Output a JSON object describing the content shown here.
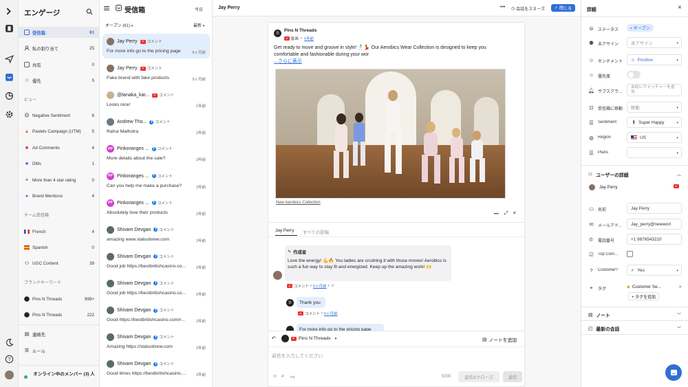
{
  "sidebar": {
    "title": "エンゲージ",
    "items": [
      {
        "label": "受信箱",
        "count": "61"
      },
      {
        "label": "私の割り当て",
        "count": "25"
      },
      {
        "label": "共有",
        "count": "0"
      },
      {
        "label": "優先",
        "count": "5"
      }
    ],
    "views_header": "ビュー",
    "views": [
      {
        "label": "Negative Sentiment",
        "count": "6"
      },
      {
        "label": "Pastels Campaign (UTM)",
        "count": "5"
      },
      {
        "label": "Ad Comments",
        "count": "4"
      },
      {
        "label": "DMs",
        "count": "1"
      },
      {
        "label": "More than 4 star rating",
        "count": "0"
      },
      {
        "label": "Brand Mentions",
        "count": "4"
      }
    ],
    "team_header": "チーム受信箱",
    "teams": [
      {
        "label": "French",
        "count": "4"
      },
      {
        "label": "Spanish",
        "count": "0"
      },
      {
        "label": "UGC Content",
        "count": "39"
      }
    ],
    "brand_header": "ブランドキーワード",
    "brands": [
      {
        "label": "Pins N Threads",
        "count": "999+"
      },
      {
        "label": "Pins N Threads",
        "count": "222"
      }
    ],
    "contacts": "連絡先",
    "rules": "ルール",
    "online": "オンライン中のメンバー (3) 人"
  },
  "list": {
    "title": "受信箱",
    "today": "今日",
    "filter": "オープン (61)",
    "sort": "最新",
    "items": [
      {
        "name": "Jay Perry",
        "channel": "yt",
        "tag": "コメント",
        "preview": "For more info go to the pricing page",
        "time": "5ヶ月前",
        "av": "JP"
      },
      {
        "name": "Jay Perry",
        "channel": "yt",
        "tag": "コメント",
        "preview": "Fake brand with fake products",
        "time": "5ヶ月前",
        "av": "JP"
      },
      {
        "name": "@tanaka_kar...",
        "channel": "yt",
        "tag": "コメント",
        "preview": "Looks nice!",
        "time": "1年前",
        "av": "T"
      },
      {
        "name": "Andrew Tho...",
        "channel": "fb",
        "tag": "コメント",
        "preview": "Rahul Malhotra",
        "time": "2年前",
        "av": "A"
      },
      {
        "name": "Pinkoranges ...",
        "channel": "fb",
        "tag": "コメント",
        "preview": "More details about the sale?",
        "time": "2年前",
        "av": "PP"
      },
      {
        "name": "Pinkoranges ...",
        "channel": "fb",
        "tag": "コメント",
        "preview": "Can you help me make a purchase?",
        "time": "2年前",
        "av": "PP"
      },
      {
        "name": "Pinkoranges ...",
        "channel": "fb",
        "tag": "コメント",
        "preview": "Absolutely love their products",
        "time": "2年前",
        "av": "PP"
      },
      {
        "name": "Shivam Devgan",
        "channel": "fb",
        "tag": "コメント",
        "preview": "amazing www.statusbrew.com",
        "time": "2年前",
        "av": "S"
      },
      {
        "name": "Shivam Devgan",
        "channel": "fb",
        "tag": "コメント",
        "preview": "Good job https://bestbritishcasino.co...",
        "time": "2年前",
        "av": "S"
      },
      {
        "name": "Shivam Devgan",
        "channel": "fb",
        "tag": "コメント",
        "preview": "Good job https://bestbritishcasino.co...",
        "time": "2年前",
        "av": "S"
      },
      {
        "name": "Shivam Devgan",
        "channel": "fb",
        "tag": "コメント",
        "preview": "Good https://bestbritishcasino.com/r...",
        "time": "2年前",
        "av": "S"
      },
      {
        "name": "Shivam Devgan",
        "channel": "fb",
        "tag": "コメント",
        "preview": "Amazing https://statusbrew.com",
        "time": "2年前",
        "av": "S"
      },
      {
        "name": "Shivam Devgan",
        "channel": "fb",
        "tag": "コメント",
        "preview": "Good times https://bestbritishcasino....",
        "time": "2年前",
        "av": "S"
      }
    ]
  },
  "conversation": {
    "header_name": "Jay Perry",
    "snooze": "会話をスヌーズ",
    "close": "閉じる",
    "post_author": "Pins N Threads",
    "post_type": "動画",
    "post_time": "1年前",
    "post_text": "Get ready to move and groove in style! 🕺💃 Our Aerobics Wear Collection is designed to keep you comfortable and fashionable during your wor",
    "show_more": "...さらに表示",
    "video_caption": "New Aerobics Collection",
    "tab1": "Jay Perry",
    "tab2": "すべての投稿",
    "author_label": "作成者",
    "comment": "Love the energy! 💪🔥 You ladies are crushing it with those moves! Aerobics is such a fun way to stay fit and energized. Keep up the amazing work! 🙌",
    "comment_tag": "コメント",
    "comment_time": "5ヶ月前",
    "reply1": "Thank you",
    "reply1_tag": "コメント",
    "reply1_time": "5ヶ月前",
    "reply2": "For more info go to the pricing page",
    "composer_account": "Pins N Threads",
    "add_note": "ノートを追加",
    "placeholder": "返信を入力してください",
    "char_count": "5000",
    "reply_close": "返信&クローズ",
    "reply": "返信"
  },
  "details": {
    "title": "詳細",
    "fields": [
      {
        "label": "ステータス",
        "value": "オープン"
      },
      {
        "label": "未アサイン",
        "value": "未アサイン"
      },
      {
        "label": "センチメント",
        "value": "Positive"
      },
      {
        "label": "優先度",
        "value": ""
      },
      {
        "label": "サブスクラ...",
        "value": "会話にウォッチャーを追加"
      },
      {
        "label": "受信箱に移動",
        "value": "移動"
      },
      {
        "label": "Sentiment",
        "value": "Super Happy"
      },
      {
        "label": "Region",
        "value": "US"
      },
      {
        "label": "Plans",
        "value": ""
      }
    ],
    "user_header": "ユーザーの詳細",
    "user_name": "Jay Perry",
    "user_fields": [
      {
        "label": "名前",
        "value": "Jay Perry"
      },
      {
        "label": "メールアド...",
        "value": "Jay_perry@newworl"
      },
      {
        "label": "電話番号",
        "value": "+1 9876543210"
      },
      {
        "label": "Top Com...",
        "value": ""
      },
      {
        "label": "Customer?",
        "value": "Yes"
      },
      {
        "label": "タグ",
        "value": "Customer Se..."
      }
    ],
    "add_tag": "+ タグを追加",
    "notes": "ノート",
    "recent": "最新の会話"
  },
  "colors": {
    "accent": "#2f6fd6",
    "selected": "#e3eefc",
    "youtube": "#e33333",
    "facebook": "#1877f2"
  }
}
